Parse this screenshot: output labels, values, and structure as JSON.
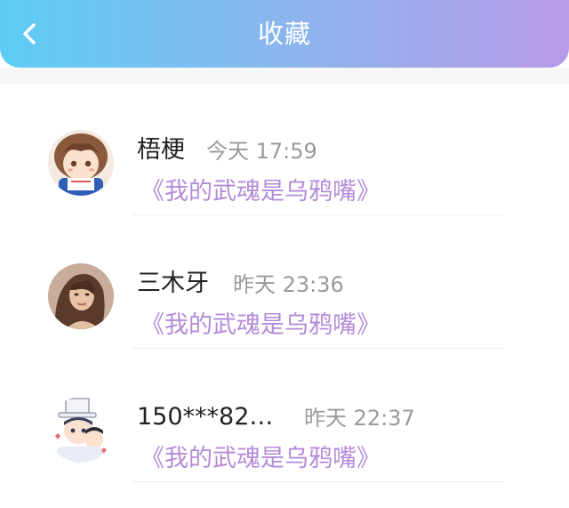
{
  "header": {
    "title": "收藏",
    "back_icon": "chevron-left-icon",
    "gradient": [
      "#5ccdf5",
      "#b79ae8"
    ]
  },
  "favorites": [
    {
      "name": "梧梗",
      "time": "今天 17:59",
      "book": "《我的武魂是乌鸦嘴》",
      "avatar": "anime-boy-avatar"
    },
    {
      "name": "三木牙",
      "time": "昨天 23:36",
      "book": "《我的武魂是乌鸦嘴》",
      "avatar": "woman-photo-avatar"
    },
    {
      "name": "150***82…",
      "time": "昨天 22:37",
      "book": "《我的武魂是乌鸦嘴》",
      "avatar": "anime-thief-avatar"
    }
  ],
  "colors": {
    "book_title": "#b48bd8",
    "time": "#9a9a9a",
    "name": "#222222"
  }
}
